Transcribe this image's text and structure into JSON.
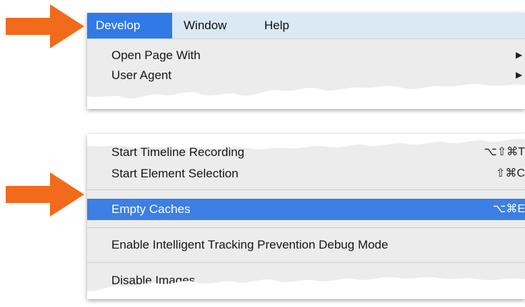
{
  "colors": {
    "arrow": "#f26a1b",
    "highlight": "#3c7fe5",
    "menubar": "#dbe9f5",
    "menu_bg": "#ececec"
  },
  "icons": {
    "arrow": "arrow-right-icon",
    "submenu": "submenu-triangle-icon"
  },
  "menubar": {
    "items": [
      {
        "label": "Develop",
        "active": true
      },
      {
        "label": "Window"
      },
      {
        "label": "Help"
      }
    ]
  },
  "menu_top": {
    "items": [
      {
        "label": "Open Page With",
        "submenu_glyph": "▶"
      },
      {
        "label": "User Agent",
        "submenu_glyph": "▶"
      }
    ]
  },
  "menu_bottom": {
    "items": [
      {
        "label": "Start Timeline Recording",
        "shortcut": "⌥⇧⌘T"
      },
      {
        "label": "Start Element Selection",
        "shortcut": "⇧⌘C"
      },
      {
        "label": "Empty Caches",
        "shortcut": "⌥⌘E",
        "highlighted": true
      },
      {
        "label": "Enable Intelligent Tracking Prevention Debug Mode"
      },
      {
        "label": "Disable Images"
      }
    ]
  }
}
